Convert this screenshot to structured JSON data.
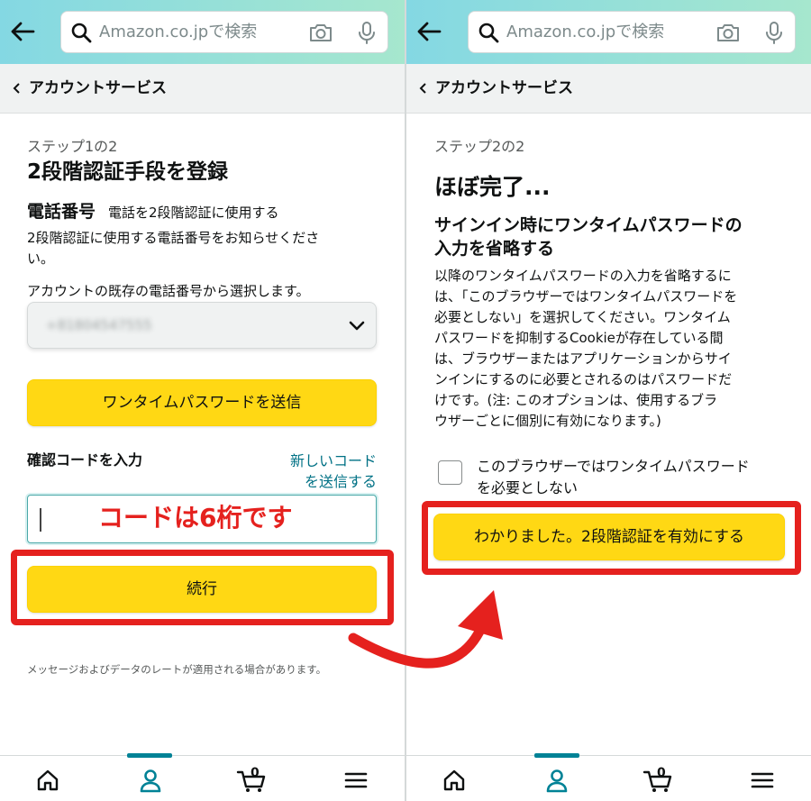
{
  "search": {
    "placeholder": "Amazon.co.jpで検索"
  },
  "breadcrumb": "アカウントサービス",
  "left": {
    "step": "ステップ1の2",
    "title": "2段階認証手段を登録",
    "phone_label": "電話番号",
    "phone_sub": "電話を2段階認証に使用する",
    "desc_line1": "2段階認証に使用する電話番号をお知らせくださ",
    "desc_line2": "い。",
    "select_label": "アカウントの既存の電話番号から選択します。",
    "select_value": "+81804547555",
    "send_otp_button": "ワンタイムパスワードを送信",
    "code_label": "確認コードを入力",
    "new_code_link_line1": "新しいコード",
    "new_code_link_line2": "を送信する",
    "annotation": "コードは6桁です",
    "continue_button": "続行",
    "footnote": "メッセージおよびデータのレートが適用される場合があります。"
  },
  "right": {
    "step": "ステップ2の2",
    "title": "ほぼ完了...",
    "subtitle_line1": "サインイン時にワンタイムパスワードの",
    "subtitle_line2": "入力を省略する",
    "body_lines": [
      "以降のワンタイムパスワードの入力を省略するに",
      "は、「このブラウザーではワンタイムパスワードを",
      "必要としない」を選択してください。ワンタイム",
      "パスワードを抑制するCookieが存在している間",
      "は、ブラウザーまたはアプリケーションからサイ",
      "ンインにするのに必要とされるのはパスワードだ",
      "けです。(注: このオプションは、使用するブラ",
      "ウザーごとに個別に有効になります。)"
    ],
    "checkbox_line1": "このブラウザーではワンタイムパスワード",
    "checkbox_line2": "を必要としない",
    "enable_button": "わかりました。2段階認証を有効にする"
  },
  "nav": {
    "cart_count": "0"
  },
  "colors": {
    "accent_yellow": "#ffd814",
    "annotation_red": "#e5211e",
    "link_teal": "#007185",
    "nav_indicator": "#008296"
  },
  "icons": [
    "back-arrow-icon",
    "search-icon",
    "camera-icon",
    "microphone-icon",
    "chevron-left-icon",
    "chevron-down-icon",
    "home-icon",
    "account-icon",
    "cart-icon",
    "menu-icon"
  ]
}
